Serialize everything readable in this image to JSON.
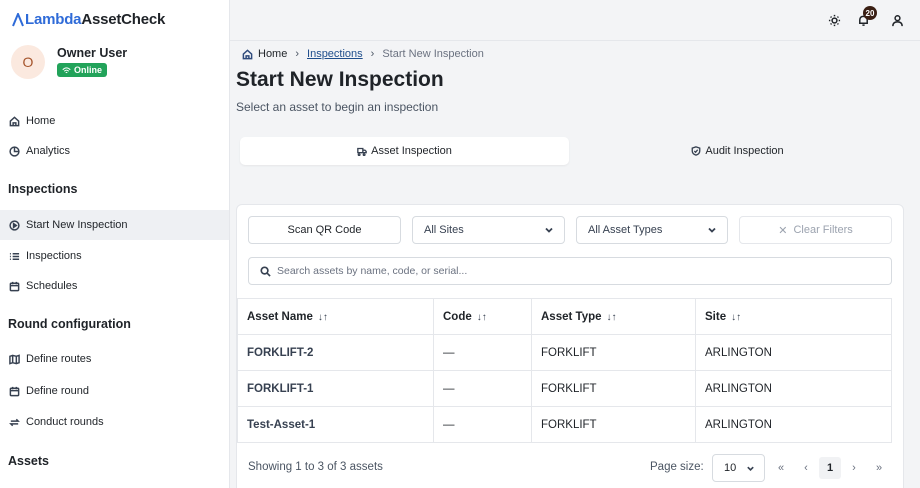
{
  "brand": {
    "part1": "Lambda",
    "part2": "AssetCheck"
  },
  "user": {
    "initial": "O",
    "name": "Owner User",
    "status": "Online"
  },
  "sidebar": {
    "top_items": [
      {
        "label": "Home"
      },
      {
        "label": "Analytics"
      }
    ],
    "sections": [
      {
        "title": "Inspections",
        "items": [
          {
            "label": "Start New Inspection"
          },
          {
            "label": "Inspections"
          },
          {
            "label": "Schedules"
          }
        ]
      },
      {
        "title": "Round configuration",
        "items": [
          {
            "label": "Define routes"
          },
          {
            "label": "Define round"
          },
          {
            "label": "Conduct rounds"
          }
        ]
      },
      {
        "title": "Assets"
      }
    ]
  },
  "topbar": {
    "notification_count": "20"
  },
  "breadcrumb": {
    "home": "Home",
    "inspections": "Inspections",
    "current": "Start New Inspection"
  },
  "page": {
    "title": "Start New Inspection",
    "subtitle": "Select an asset to begin an inspection"
  },
  "tabs": [
    {
      "label": "Asset Inspection",
      "active": true
    },
    {
      "label": "Audit Inspection",
      "active": false
    }
  ],
  "filters": {
    "scan_label": "Scan QR Code",
    "sites_selected": "All Sites",
    "types_selected": "All Asset Types",
    "clear_label": "Clear Filters",
    "search_placeholder": "Search assets by name, code, or serial..."
  },
  "table": {
    "columns": [
      "Asset Name",
      "Code",
      "Asset Type",
      "Site"
    ],
    "rows": [
      [
        "FORKLIFT-2",
        "—",
        "FORKLIFT",
        "ARLINGTON"
      ],
      [
        "FORKLIFT-1",
        "—",
        "FORKLIFT",
        "ARLINGTON"
      ],
      [
        "Test-Asset-1",
        "—",
        "FORKLIFT",
        "ARLINGTON"
      ]
    ]
  },
  "pagination": {
    "summary": "Showing 1 to 3 of 3 assets",
    "page_size_label": "Page size:",
    "page_size": "10",
    "first": "«",
    "prev": "‹",
    "current": "1",
    "next": "›",
    "last": "»"
  }
}
